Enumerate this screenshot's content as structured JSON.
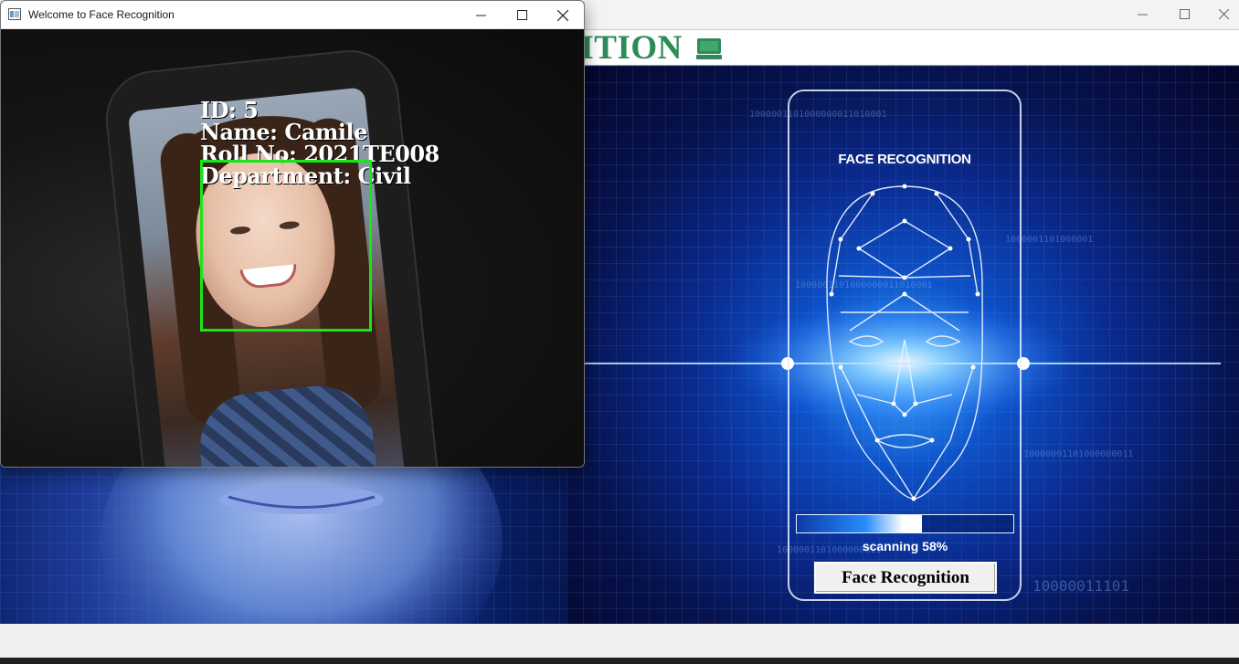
{
  "background_window": {
    "header_title": "RECOGNITION",
    "header_icon": "monitor-icon",
    "minimize_icon": "minimize-icon",
    "maximize_icon": "maximize-icon",
    "close_icon": "close-icon",
    "phone_title": "FACE RECOGNITION",
    "scan_label": "scanning 58%",
    "scan_progress": 0.58,
    "button_label": "Face Recognition",
    "accent_color": "#2e8b57"
  },
  "camera_window": {
    "title": "Welcome to Face Recognition",
    "app_icon": "window-app-icon",
    "detection": {
      "id_line": "ID: 5",
      "name_line": "Name: Camile",
      "roll_line": "Roll No: 2021TE008",
      "dept_line": "Department: Civil",
      "box_color": "#19e619"
    }
  }
}
